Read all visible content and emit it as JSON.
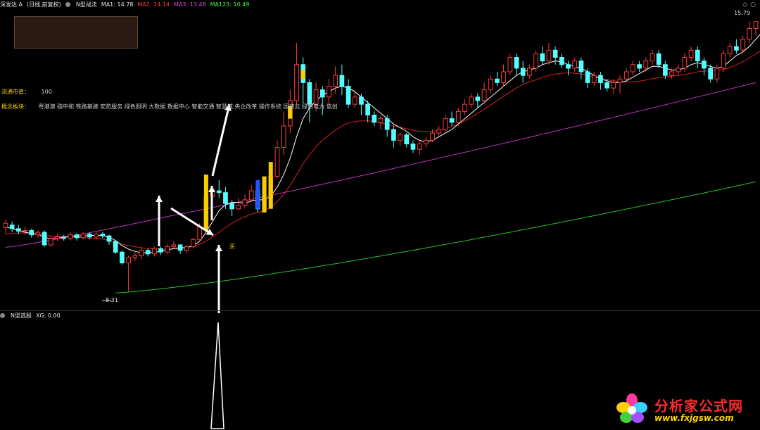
{
  "header": {
    "stock_name": "深发达 A",
    "period_label": "(日线,前复权)",
    "indicator_name": "N型战法",
    "ma1": "MA1: 14.78",
    "ma2": "MA2: 14.14",
    "ma3": "MA3: 13.48",
    "ma123": "MA123: 10.49"
  },
  "info": {
    "float_cap_label": "流通市值：",
    "float_cap_value": "100",
    "concept_label": "概念板块：",
    "concept_value": "粤港澳  碳中和  铁路基建  安防服务  绿色照明  大数据  数据中心  智能交通  智慧城  央企改革  操作系统  国资云  绿色电力  信创"
  },
  "price": {
    "high_label": "15.79",
    "low_label": "8.31",
    "buy_label": "买"
  },
  "sub_panel": {
    "indicator_name": "N型选股",
    "xg_value": "XG: 0.00"
  },
  "watermark": {
    "title": "分析家公式网",
    "url": "www.fxjgsw.com"
  },
  "colors": {
    "up": "#ff3b3b",
    "down": "#54ffff",
    "ma_white": "#ffffff",
    "ma_red": "#d42020",
    "ma_magenta": "#c030c0",
    "ma_green": "#28c028",
    "signal_yellow": "#f5d000",
    "signal_blue": "#2255ff"
  },
  "icons": {
    "header_circle": "circle-icon",
    "corner": "settings-diamond-icon"
  },
  "chart_data": {
    "type": "candlestick",
    "title": "深发达 A",
    "price_range": [
      8.31,
      15.79
    ],
    "candles": [
      [
        10.08,
        10.2,
        10.3,
        9.9
      ],
      [
        10.15,
        10.05,
        10.25,
        9.95
      ],
      [
        10.05,
        9.98,
        10.15,
        9.9
      ],
      [
        9.98,
        10.0,
        10.1,
        9.88
      ],
      [
        10.0,
        9.88,
        10.05,
        9.8
      ],
      [
        9.88,
        9.95,
        10.0,
        9.8
      ],
      [
        9.95,
        9.6,
        10.0,
        9.55
      ],
      [
        9.6,
        9.78,
        9.85,
        9.55
      ],
      [
        9.78,
        9.82,
        9.9,
        9.7
      ],
      [
        9.82,
        9.78,
        9.88,
        9.72
      ],
      [
        9.78,
        9.88,
        9.95,
        9.72
      ],
      [
        9.88,
        9.8,
        9.92,
        9.72
      ],
      [
        9.8,
        9.9,
        9.95,
        9.75
      ],
      [
        9.9,
        9.82,
        9.95,
        9.76
      ],
      [
        9.82,
        9.9,
        9.98,
        9.75
      ],
      [
        9.9,
        9.85,
        9.96,
        9.78
      ],
      [
        9.85,
        9.7,
        9.88,
        9.6
      ],
      [
        9.7,
        9.4,
        9.72,
        9.35
      ],
      [
        9.4,
        9.1,
        9.45,
        9.05
      ],
      [
        9.1,
        9.25,
        9.3,
        8.31
      ],
      [
        9.25,
        9.3,
        9.4,
        9.15
      ],
      [
        9.3,
        9.45,
        9.55,
        9.2
      ],
      [
        9.45,
        9.35,
        9.5,
        9.28
      ],
      [
        9.35,
        9.5,
        9.55,
        9.28
      ],
      [
        9.5,
        9.4,
        9.55,
        9.32
      ],
      [
        9.4,
        9.55,
        9.62,
        9.35
      ],
      [
        9.55,
        9.6,
        9.7,
        9.5
      ],
      [
        9.6,
        9.45,
        9.62,
        9.35
      ],
      [
        9.45,
        9.55,
        9.6,
        9.38
      ],
      [
        9.55,
        9.75,
        9.8,
        9.5
      ],
      [
        9.75,
        10.1,
        10.2,
        9.7
      ],
      [
        10.1,
        10.95,
        11.0,
        10.05
      ],
      [
        10.95,
        11.1,
        11.2,
        10.7
      ],
      [
        11.1,
        11.05,
        11.4,
        10.9
      ],
      [
        11.05,
        10.75,
        11.2,
        10.6
      ],
      [
        10.75,
        10.6,
        10.85,
        10.4
      ],
      [
        10.6,
        10.7,
        10.9,
        10.55
      ],
      [
        10.7,
        10.85,
        11.0,
        10.62
      ],
      [
        10.85,
        11.1,
        11.25,
        10.8
      ],
      [
        11.1,
        10.6,
        11.2,
        10.5
      ],
      [
        10.6,
        10.9,
        11.0,
        10.5
      ],
      [
        10.9,
        11.5,
        11.7,
        10.85
      ],
      [
        11.5,
        12.3,
        12.5,
        11.45
      ],
      [
        12.3,
        12.9,
        13.3,
        12.1
      ],
      [
        12.9,
        13.6,
        13.9,
        12.7
      ],
      [
        13.6,
        14.6,
        15.2,
        13.5
      ],
      [
        14.6,
        14.1,
        14.8,
        13.5
      ],
      [
        14.1,
        13.5,
        14.2,
        13.0
      ],
      [
        13.5,
        13.9,
        14.1,
        13.3
      ],
      [
        13.9,
        13.7,
        14.0,
        13.2
      ],
      [
        13.7,
        14.0,
        14.2,
        13.4
      ],
      [
        14.0,
        14.3,
        14.55,
        13.8
      ],
      [
        14.3,
        14.0,
        14.6,
        13.75
      ],
      [
        14.0,
        13.5,
        14.2,
        13.4
      ],
      [
        13.5,
        13.7,
        13.9,
        13.4
      ],
      [
        13.7,
        13.5,
        13.8,
        13.2
      ],
      [
        13.5,
        13.2,
        13.6,
        13.0
      ],
      [
        13.2,
        13.0,
        13.3,
        12.9
      ],
      [
        13.0,
        13.1,
        13.2,
        12.8
      ],
      [
        13.1,
        12.8,
        13.2,
        12.6
      ],
      [
        12.8,
        12.5,
        12.9,
        12.3
      ],
      [
        12.5,
        12.65,
        12.7,
        12.35
      ],
      [
        12.65,
        12.4,
        12.7,
        12.3
      ],
      [
        12.4,
        12.25,
        12.5,
        12.15
      ],
      [
        12.25,
        12.4,
        12.5,
        12.1
      ],
      [
        12.4,
        12.5,
        12.6,
        12.3
      ],
      [
        12.5,
        12.7,
        12.8,
        12.45
      ],
      [
        12.7,
        12.8,
        12.9,
        12.6
      ],
      [
        12.8,
        13.1,
        13.2,
        12.7
      ],
      [
        13.1,
        13.0,
        13.3,
        12.9
      ],
      [
        13.0,
        13.3,
        13.4,
        12.9
      ],
      [
        13.3,
        13.5,
        13.65,
        13.2
      ],
      [
        13.5,
        13.7,
        13.8,
        13.4
      ],
      [
        13.7,
        13.6,
        13.8,
        13.4
      ],
      [
        13.6,
        13.9,
        14.1,
        13.5
      ],
      [
        13.9,
        14.2,
        14.3,
        13.8
      ],
      [
        14.2,
        14.1,
        14.4,
        14.0
      ],
      [
        14.1,
        14.4,
        14.6,
        14.0
      ],
      [
        14.4,
        14.8,
        14.9,
        14.3
      ],
      [
        14.8,
        14.5,
        14.9,
        14.3
      ],
      [
        14.5,
        14.3,
        14.7,
        14.1
      ],
      [
        14.3,
        14.5,
        14.6,
        14.2
      ],
      [
        14.5,
        14.9,
        15.0,
        14.4
      ],
      [
        14.9,
        14.7,
        15.1,
        14.6
      ],
      [
        14.7,
        15.0,
        15.2,
        14.6
      ],
      [
        15.0,
        14.8,
        15.1,
        14.6
      ],
      [
        14.8,
        14.6,
        14.9,
        14.5
      ],
      [
        14.6,
        14.5,
        14.7,
        14.3
      ],
      [
        14.5,
        14.7,
        14.8,
        14.4
      ],
      [
        14.7,
        14.4,
        14.8,
        14.2
      ],
      [
        14.4,
        14.1,
        14.5,
        13.95
      ],
      [
        14.1,
        14.3,
        14.4,
        14.0
      ],
      [
        14.3,
        14.1,
        14.4,
        13.9
      ],
      [
        14.1,
        13.95,
        14.2,
        13.85
      ],
      [
        13.95,
        14.1,
        14.2,
        13.8
      ],
      [
        14.1,
        14.2,
        14.3,
        13.8
      ],
      [
        14.2,
        14.4,
        14.5,
        14.1
      ],
      [
        14.4,
        14.6,
        14.7,
        14.3
      ],
      [
        14.6,
        14.5,
        14.7,
        14.4
      ],
      [
        14.5,
        14.7,
        14.8,
        14.4
      ],
      [
        14.7,
        14.9,
        15.0,
        14.6
      ],
      [
        14.9,
        14.6,
        15.0,
        14.5
      ],
      [
        14.6,
        14.3,
        14.7,
        14.2
      ],
      [
        14.3,
        14.4,
        14.5,
        14.2
      ],
      [
        14.4,
        14.5,
        14.6,
        14.3
      ],
      [
        14.5,
        14.8,
        14.9,
        14.4
      ],
      [
        14.8,
        15.0,
        15.1,
        14.7
      ],
      [
        15.0,
        14.7,
        15.1,
        14.5
      ],
      [
        14.7,
        14.5,
        14.8,
        14.3
      ],
      [
        14.5,
        14.2,
        14.6,
        14.1
      ],
      [
        14.2,
        14.5,
        14.6,
        14.1
      ],
      [
        14.5,
        14.9,
        15.0,
        14.4
      ],
      [
        14.9,
        15.1,
        15.2,
        14.8
      ],
      [
        15.1,
        15.0,
        15.3,
        14.9
      ],
      [
        15.0,
        15.3,
        15.4,
        14.9
      ],
      [
        15.3,
        15.6,
        15.8,
        15.2
      ],
      [
        15.6,
        15.79,
        15.79,
        15.4
      ]
    ],
    "ma_white": [
      10.1,
      10.05,
      10.0,
      9.95,
      9.92,
      9.9,
      9.8,
      9.78,
      9.8,
      9.82,
      9.84,
      9.85,
      9.85,
      9.86,
      9.87,
      9.86,
      9.82,
      9.72,
      9.58,
      9.48,
      9.42,
      9.38,
      9.38,
      9.4,
      9.42,
      9.46,
      9.5,
      9.52,
      9.53,
      9.58,
      9.7,
      9.95,
      10.25,
      10.55,
      10.72,
      10.78,
      10.78,
      10.75,
      10.82,
      10.85,
      10.85,
      10.95,
      11.2,
      11.55,
      12.0,
      12.6,
      13.1,
      13.4,
      13.6,
      13.75,
      13.85,
      13.95,
      14.0,
      13.95,
      13.85,
      13.7,
      13.55,
      13.4,
      13.25,
      13.1,
      12.95,
      12.85,
      12.75,
      12.6,
      12.5,
      12.45,
      12.5,
      12.6,
      12.7,
      12.8,
      12.95,
      13.1,
      13.25,
      13.4,
      13.55,
      13.7,
      13.85,
      14.0,
      14.15,
      14.3,
      14.4,
      14.45,
      14.5,
      14.6,
      14.65,
      14.7,
      14.68,
      14.6,
      14.55,
      14.5,
      14.4,
      14.3,
      14.2,
      14.15,
      14.1,
      14.1,
      14.15,
      14.25,
      14.35,
      14.45,
      14.55,
      14.55,
      14.5,
      14.45,
      14.45,
      14.5,
      14.6,
      14.65,
      14.6,
      14.55,
      14.5,
      14.55,
      14.7,
      14.85,
      14.95,
      15.1,
      15.3,
      15.5
    ],
    "ma_red": [
      9.9,
      9.92,
      9.93,
      9.93,
      9.92,
      9.9,
      9.88,
      9.85,
      9.84,
      9.83,
      9.82,
      9.81,
      9.8,
      9.79,
      9.78,
      9.76,
      9.72,
      9.68,
      9.62,
      9.58,
      9.55,
      9.52,
      9.5,
      9.49,
      9.48,
      9.48,
      9.49,
      9.5,
      9.52,
      9.56,
      9.62,
      9.7,
      9.82,
      9.95,
      10.08,
      10.2,
      10.3,
      10.38,
      10.45,
      10.5,
      10.55,
      10.65,
      10.8,
      11.0,
      11.25,
      11.55,
      11.85,
      12.1,
      12.32,
      12.5,
      12.65,
      12.78,
      12.9,
      12.98,
      13.02,
      13.04,
      13.04,
      13.02,
      12.98,
      12.94,
      12.9,
      12.86,
      12.82,
      12.78,
      12.75,
      12.74,
      12.75,
      12.78,
      12.82,
      12.88,
      12.95,
      13.04,
      13.14,
      13.25,
      13.36,
      13.48,
      13.6,
      13.72,
      13.84,
      13.95,
      14.05,
      14.12,
      14.18,
      14.24,
      14.3,
      14.34,
      14.36,
      14.37,
      14.36,
      14.34,
      14.3,
      14.26,
      14.22,
      14.18,
      14.15,
      14.13,
      14.12,
      14.12,
      14.14,
      14.17,
      14.21,
      14.24,
      14.26,
      14.28,
      14.3,
      14.32,
      14.36,
      14.4,
      14.42,
      14.43,
      14.44,
      14.46,
      14.52,
      14.6,
      14.68,
      14.78,
      14.9,
      15.02
    ],
    "ma_magenta_start": 9.62,
    "ma_magenta_end": 14.1,
    "ma_green_start": 8.27,
    "ma_green_end": 11.35
  }
}
